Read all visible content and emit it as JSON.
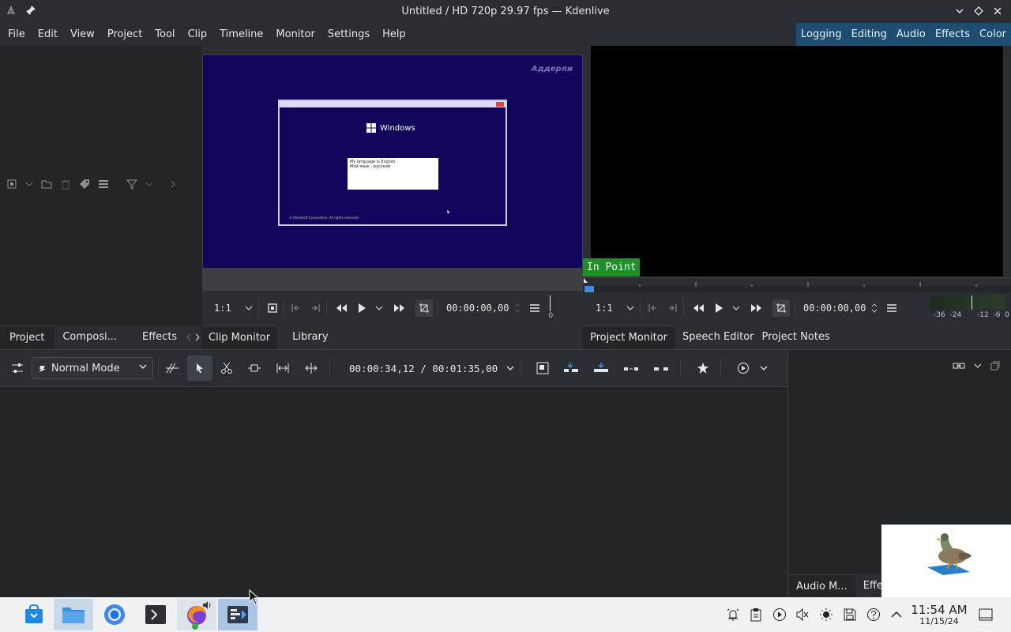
{
  "window": {
    "title": "Untitled / HD 720p 29.97 fps — Kdenlive"
  },
  "menu": [
    "File",
    "Edit",
    "View",
    "Project",
    "Tool",
    "Clip",
    "Timeline",
    "Monitor",
    "Settings",
    "Help"
  ],
  "layouts": [
    "Logging",
    "Editing",
    "Audio",
    "Effects",
    "Color"
  ],
  "left_panel": {
    "tabs": [
      "Project ...",
      "Composi...",
      "Effects"
    ]
  },
  "clip_monitor": {
    "zoom": "1:1",
    "timecode": "00:00:00,00",
    "scale_zero": "0",
    "screen": {
      "watermark": "Аддерли",
      "windows_label": "Windows",
      "dialog_line1": "My language is English",
      "dialog_line2": "Мой язык - русский",
      "footer": "© Microsoft Corporation. All rights reserved."
    },
    "tabs": [
      "Clip Monitor",
      "Library"
    ]
  },
  "project_monitor": {
    "in_point": "In Point",
    "zoom": "1:1",
    "timecode": "00:00:00,00",
    "audio_scale": [
      "-36",
      "-24",
      "-12",
      "-6",
      "0"
    ],
    "tabs": [
      "Project Monitor",
      "Speech Editor",
      "Project Notes"
    ]
  },
  "timeline": {
    "mode": "Normal Mode",
    "timecode": "00:00:34,12 / 00:01:35,00"
  },
  "right_bottom": {
    "tabs": [
      "Audio M...",
      "Effec"
    ]
  },
  "taskbar": {
    "time": "11:54 AM",
    "date": "11/15/24"
  },
  "colors": {
    "accent": "#1d4e71",
    "in_point": "#1f8f2a",
    "screen_bg": "#12065a"
  }
}
